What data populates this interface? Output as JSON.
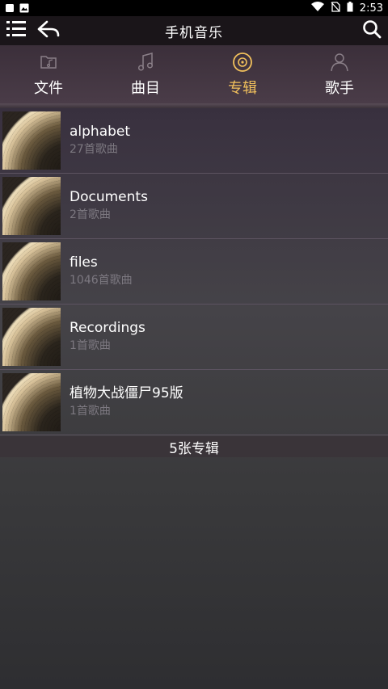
{
  "status_bar": {
    "time": "2:53",
    "icons": [
      "notification-square-icon",
      "image-icon",
      "wifi-icon",
      "no-sim-icon",
      "battery-icon"
    ]
  },
  "toolbar": {
    "title": "手机音乐",
    "menu_icon": "list-menu-icon",
    "back_icon": "reply-back-icon",
    "search_icon": "search-icon"
  },
  "tabs": [
    {
      "label": "文件",
      "icon": "folder-music-icon",
      "active": false
    },
    {
      "label": "曲目",
      "icon": "music-note-icon",
      "active": false
    },
    {
      "label": "专辑",
      "icon": "disc-icon",
      "active": true
    },
    {
      "label": "歌手",
      "icon": "person-icon",
      "active": false
    }
  ],
  "albums": [
    {
      "name": "alphabet",
      "count": "27首歌曲"
    },
    {
      "name": "Documents",
      "count": "2首歌曲"
    },
    {
      "name": "files",
      "count": "1046首歌曲"
    },
    {
      "name": "Recordings",
      "count": "1首歌曲"
    },
    {
      "name": "植物大战僵尸95版",
      "count": "1首歌曲"
    }
  ],
  "footer": {
    "count_label": "5张专辑"
  },
  "colors": {
    "accent": "#f2c15c",
    "toolbar_bg": "#1a1519",
    "subtext": "#7c7880"
  }
}
